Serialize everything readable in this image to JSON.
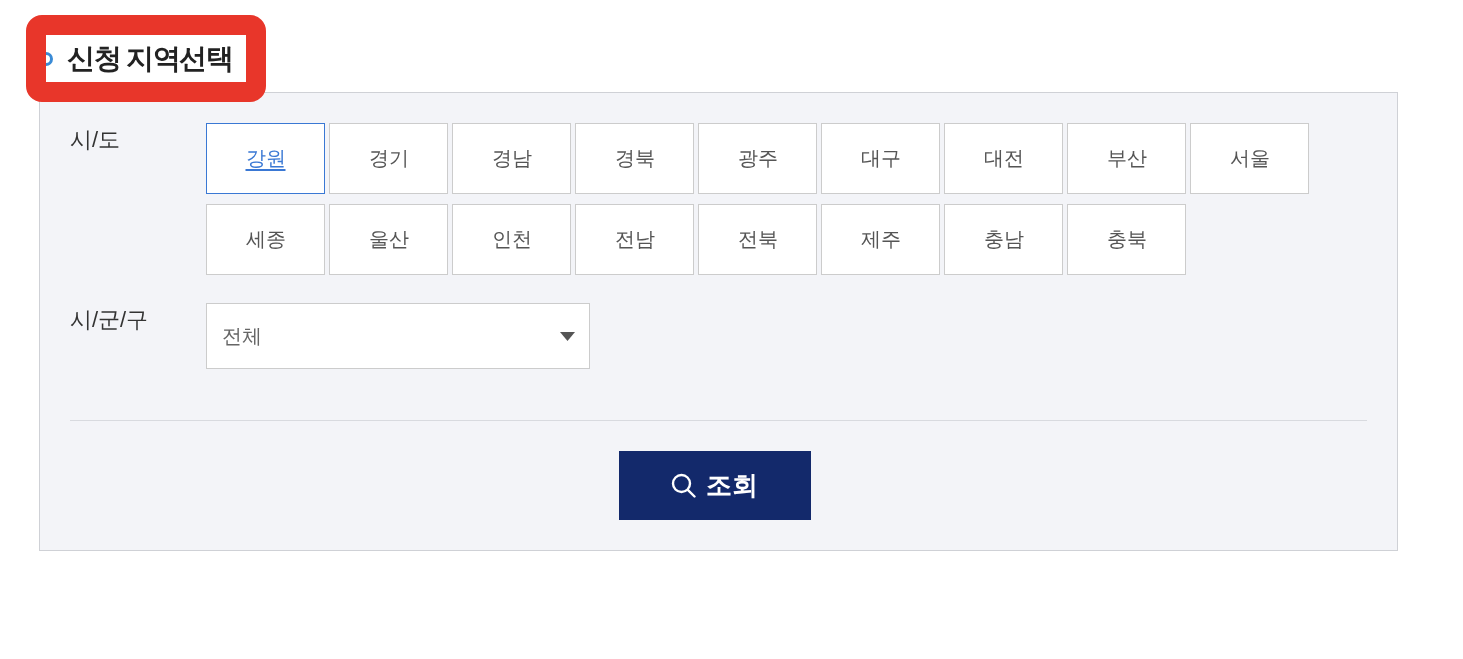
{
  "section_title": "신청 지역선택",
  "province": {
    "label": "시/도",
    "options": [
      {
        "label": "강원",
        "selected": true
      },
      {
        "label": "경기",
        "selected": false
      },
      {
        "label": "경남",
        "selected": false
      },
      {
        "label": "경북",
        "selected": false
      },
      {
        "label": "광주",
        "selected": false
      },
      {
        "label": "대구",
        "selected": false
      },
      {
        "label": "대전",
        "selected": false
      },
      {
        "label": "부산",
        "selected": false
      },
      {
        "label": "서울",
        "selected": false
      },
      {
        "label": "세종",
        "selected": false
      },
      {
        "label": "울산",
        "selected": false
      },
      {
        "label": "인천",
        "selected": false
      },
      {
        "label": "전남",
        "selected": false
      },
      {
        "label": "전북",
        "selected": false
      },
      {
        "label": "제주",
        "selected": false
      },
      {
        "label": "충남",
        "selected": false
      },
      {
        "label": "충북",
        "selected": false
      }
    ]
  },
  "district": {
    "label": "시/군/구",
    "value": "전체"
  },
  "search_button": {
    "label": "조회"
  }
}
